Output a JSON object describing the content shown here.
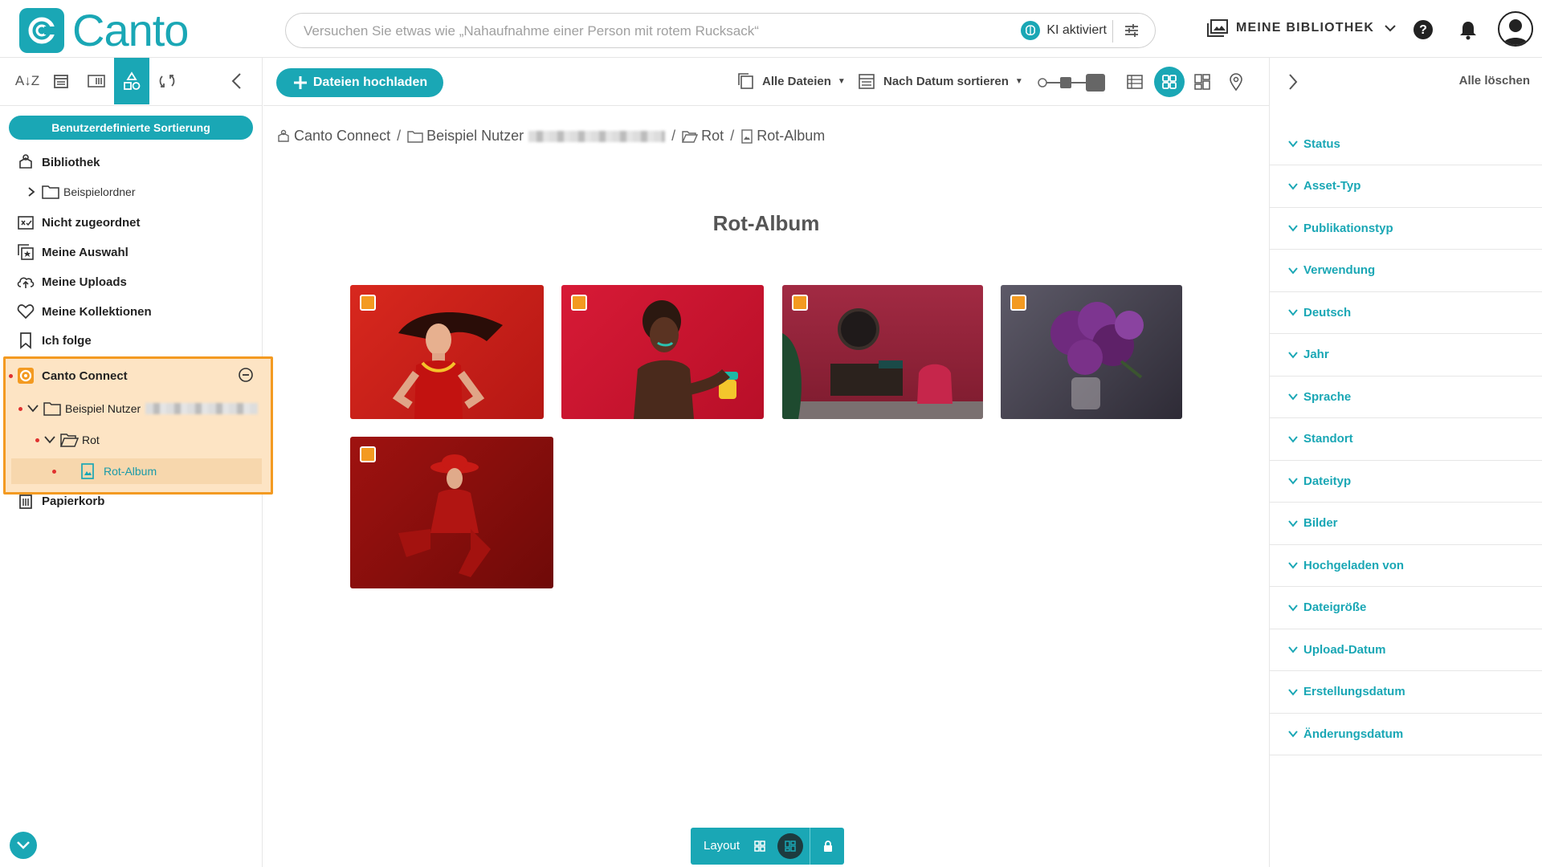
{
  "app": {
    "name": "Canto"
  },
  "search": {
    "placeholder": "Versuchen Sie etwas wie „Nahaufnahme einer Person mit rotem Rucksack“",
    "ai_label": "KI aktiviert"
  },
  "header": {
    "library_label": "MEINE BIBLIOTHEK"
  },
  "sidebar": {
    "sort_button": "Benutzerdefinierte Sortierung",
    "items": [
      {
        "label": "Bibliothek"
      },
      {
        "label": "Beispielordner"
      },
      {
        "label": "Nicht zugeordnet"
      },
      {
        "label": "Meine Auswahl"
      },
      {
        "label": "Meine Uploads"
      },
      {
        "label": "Meine Kollektionen"
      },
      {
        "label": "Ich folge"
      },
      {
        "label": "Canto Connect"
      },
      {
        "label": "Beispiel Nutzer"
      },
      {
        "label": "Rot"
      },
      {
        "label": "Rot-Album"
      },
      {
        "label": "Papierkorb"
      }
    ]
  },
  "toolbar": {
    "upload_label": "Dateien hochladen",
    "files_filter": "Alle Dateien",
    "sort_label": "Nach Datum sortieren"
  },
  "breadcrumb": [
    {
      "label": "Canto Connect"
    },
    {
      "label": "Beispiel Nutzer"
    },
    {
      "label": "Rot"
    },
    {
      "label": "Rot-Album"
    }
  ],
  "album": {
    "title": "Rot-Album"
  },
  "layout_bar": {
    "label": "Layout"
  },
  "right_panel": {
    "clear_all": "Alle löschen",
    "facets": [
      "Status",
      "Asset-Typ",
      "Publikationstyp",
      "Verwendung",
      "Deutsch",
      "Jahr",
      "Sprache",
      "Standort",
      "Dateityp",
      "Bilder",
      "Hochgeladen von",
      "Dateigröße",
      "Upload-Datum",
      "Erstellungsdatum",
      "Änderungsdatum"
    ]
  },
  "colors": {
    "accent": "#1aa7b5",
    "highlight_border": "#f39a21",
    "highlight_fill": "#fde4c4"
  }
}
